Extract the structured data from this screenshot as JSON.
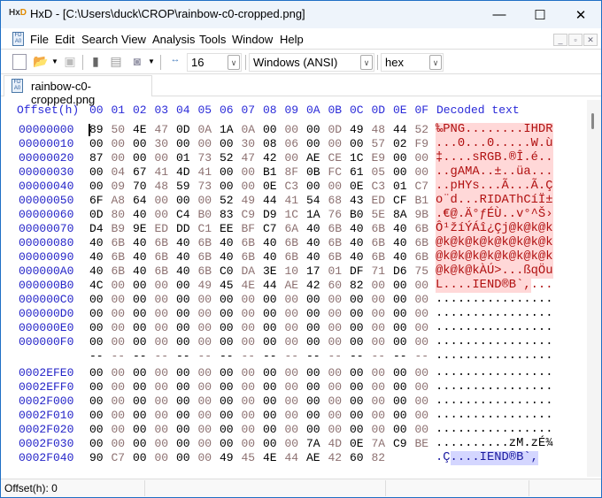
{
  "window": {
    "title": "HxD - [C:\\Users\\duck\\CROP\\rainbow-c0-cropped.png]",
    "app_icon": "HxD",
    "minimize": "—",
    "maximize": "☐",
    "close": "✕"
  },
  "menu": [
    "File",
    "Edit",
    "Search",
    "View",
    "Analysis",
    "Tools",
    "Window",
    "Help"
  ],
  "toolbar": {
    "bytes_per_row": "16",
    "charset": "Windows (ANSI)",
    "offset_base": "hex"
  },
  "tab": {
    "label": "rainbow-c0-cropped.png"
  },
  "editor": {
    "offset_header": "Offset(h)",
    "column_headers": [
      "00",
      "01",
      "02",
      "03",
      "04",
      "05",
      "06",
      "07",
      "08",
      "09",
      "0A",
      "0B",
      "0C",
      "0D",
      "0E",
      "0F"
    ],
    "decoded_header": "Decoded text",
    "rows": [
      {
        "offset": "00000000",
        "bytes": "89 50 4E 47 0D 0A 1A 0A 00 00 00 0D 49 48 44 52",
        "decoded": "‰PNG........IHDR",
        "hl": [
          0,
          16
        ]
      },
      {
        "offset": "00000010",
        "bytes": "00 00 00 30 00 00 00 30 08 06 00 00 00 57 02 F9",
        "decoded": "...0...0.....W.ù",
        "hl": [
          0,
          16
        ]
      },
      {
        "offset": "00000020",
        "bytes": "87 00 00 00 01 73 52 47 42 00 AE CE 1C E9 00 00",
        "decoded": "‡....sRGB.®Î.é..",
        "hl": [
          0,
          16
        ]
      },
      {
        "offset": "00000030",
        "bytes": "00 04 67 41 4D 41 00 00 B1 8F 0B FC 61 05 00 00",
        "decoded": "..gAMA..±..üa...",
        "hl": [
          0,
          16
        ]
      },
      {
        "offset": "00000040",
        "bytes": "00 09 70 48 59 73 00 00 0E C3 00 00 0E C3 01 C7",
        "decoded": "..pHYs...Ã...Ã.Ç",
        "hl": [
          0,
          16
        ]
      },
      {
        "offset": "00000050",
        "bytes": "6F A8 64 00 00 00 52 49 44 41 54 68 43 ED CF B1",
        "decoded": "o¨d...RIDAThCíÏ±",
        "hl": [
          0,
          16
        ]
      },
      {
        "offset": "00000060",
        "bytes": "0D 80 40 00 C4 B0 83 C9 D9 1C 1A 76 B0 5E 8A 9B",
        "decoded": ".€@.Ä°ƒÉÙ..v°^Š›",
        "hl": [
          0,
          16
        ]
      },
      {
        "offset": "00000070",
        "bytes": "D4 B9 9E ED DD C1 EE BF C7 6A 40 6B 40 6B 40 6B",
        "decoded": "Ô¹žíÝÁî¿Çj@k@k@k",
        "hl": [
          0,
          16
        ]
      },
      {
        "offset": "00000080",
        "bytes": "40 6B 40 6B 40 6B 40 6B 40 6B 40 6B 40 6B 40 6B",
        "decoded": "@k@k@k@k@k@k@k@k",
        "hl": [
          0,
          16
        ]
      },
      {
        "offset": "00000090",
        "bytes": "40 6B 40 6B 40 6B 40 6B 40 6B 40 6B 40 6B 40 6B",
        "decoded": "@k@k@k@k@k@k@k@k",
        "hl": [
          0,
          16
        ]
      },
      {
        "offset": "000000A0",
        "bytes": "40 6B 40 6B 40 6B C0 DA 3E 10 17 01 DF 71 D6 75",
        "decoded": "@k@k@kÀÚ>...ßqÖu",
        "hl": [
          0,
          16
        ]
      },
      {
        "offset": "000000B0",
        "bytes": "4C 00 00 00 00 49 45 4E 44 AE 42 60 82 00 00 00",
        "decoded": "L....IEND®B`,...",
        "hl": [
          0,
          13
        ]
      },
      {
        "offset": "000000C0",
        "bytes": "00 00 00 00 00 00 00 00 00 00 00 00 00 00 00 00",
        "decoded": "................"
      },
      {
        "offset": "000000D0",
        "bytes": "00 00 00 00 00 00 00 00 00 00 00 00 00 00 00 00",
        "decoded": "................"
      },
      {
        "offset": "000000E0",
        "bytes": "00 00 00 00 00 00 00 00 00 00 00 00 00 00 00 00",
        "decoded": "................"
      },
      {
        "offset": "000000F0",
        "bytes": "00 00 00 00 00 00 00 00 00 00 00 00 00 00 00 00",
        "decoded": "................"
      },
      {
        "offset": "",
        "bytes": "-- -- -- -- -- -- -- -- -- -- -- -- -- -- -- --",
        "decoded": "................"
      },
      {
        "offset": "0002EFE0",
        "bytes": "00 00 00 00 00 00 00 00 00 00 00 00 00 00 00 00",
        "decoded": "................"
      },
      {
        "offset": "0002EFF0",
        "bytes": "00 00 00 00 00 00 00 00 00 00 00 00 00 00 00 00",
        "decoded": "................"
      },
      {
        "offset": "0002F000",
        "bytes": "00 00 00 00 00 00 00 00 00 00 00 00 00 00 00 00",
        "decoded": "................"
      },
      {
        "offset": "0002F010",
        "bytes": "00 00 00 00 00 00 00 00 00 00 00 00 00 00 00 00",
        "decoded": "................"
      },
      {
        "offset": "0002F020",
        "bytes": "00 00 00 00 00 00 00 00 00 00 00 00 00 00 00 00",
        "decoded": "................"
      },
      {
        "offset": "0002F030",
        "bytes": "00 00 00 00 00 00 00 00 00 00 7A 4D 0E 7A C9 BE",
        "decoded": "..........zM.zÉ¾"
      },
      {
        "offset": "0002F040",
        "bytes": "90 C7 00 00 00 00 49 45 4E 44 AE 42 60 82",
        "decoded": ".Ç....IEND®B`,",
        "sel": [
          2,
          14
        ]
      }
    ]
  },
  "status": {
    "offset": "Offset(h): 0"
  },
  "colors": {
    "border": "#1f6fc5",
    "offset": "#2424c8",
    "highlight": "#ffd8d8",
    "selection": "#d4d6ff"
  }
}
